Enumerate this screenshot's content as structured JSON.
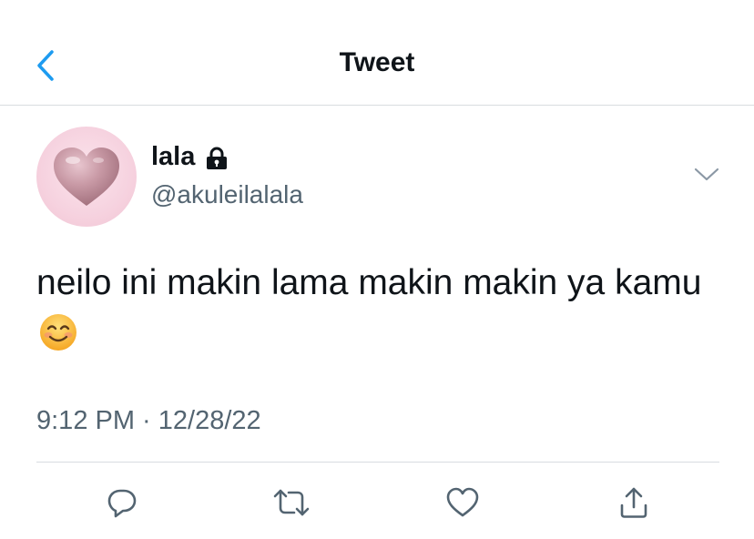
{
  "header": {
    "title": "Tweet",
    "back_icon": "chevron-left-icon"
  },
  "tweet": {
    "display_name": "lala",
    "handle": "@akuleilalala",
    "text": "neilo ini makin lama makin makin ya kamu",
    "emoji": "smiling-face-emoji",
    "timestamp": "9:12 PM · 12/28/22",
    "protected": true
  },
  "actions": [
    "reply-icon",
    "retweet-icon",
    "like-icon",
    "share-icon"
  ],
  "colors": {
    "accent": "#1d9bf0",
    "text": "#0f1419",
    "secondary": "#536471",
    "divider": "#d8dce0"
  }
}
